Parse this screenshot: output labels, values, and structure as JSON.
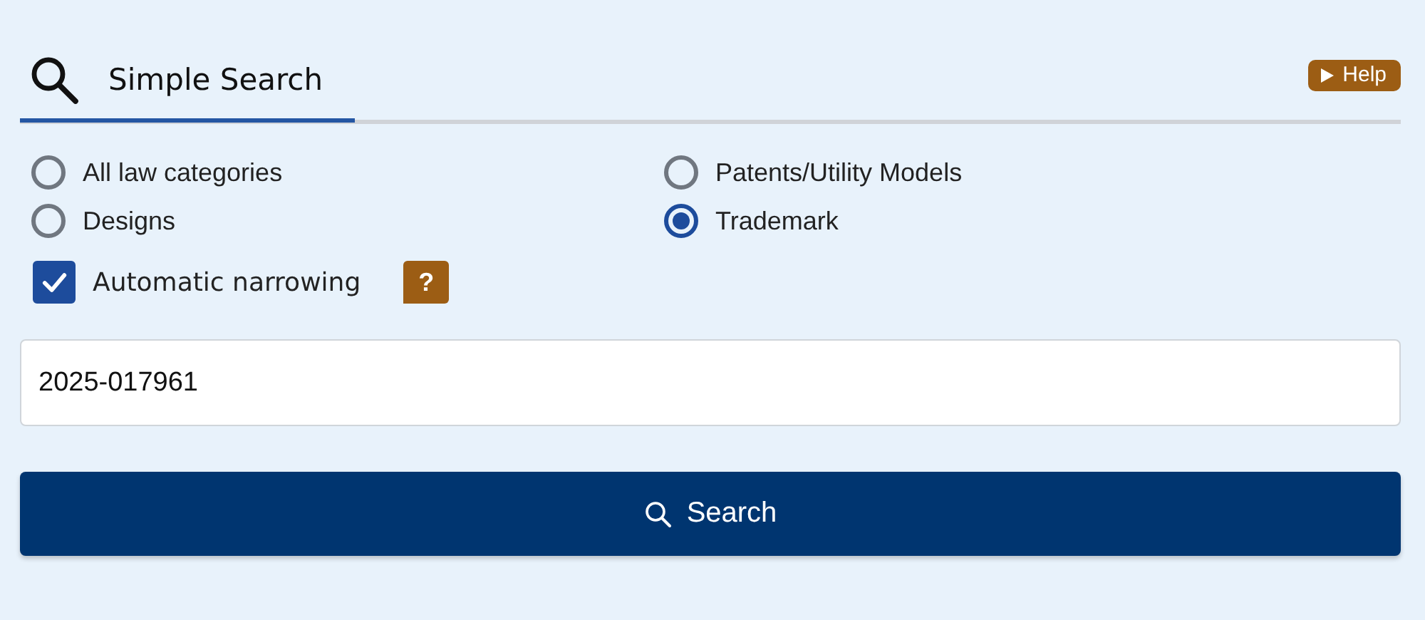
{
  "header": {
    "title": "Simple Search",
    "help_button": "Help"
  },
  "law_categories": [
    {
      "label": "All law categories",
      "selected": false
    },
    {
      "label": "Patents/Utility Models",
      "selected": false
    },
    {
      "label": "Designs",
      "selected": false
    },
    {
      "label": "Trademark",
      "selected": true
    }
  ],
  "auto_narrowing": {
    "label": "Automatic narrowing",
    "checked": true,
    "help_icon": "?"
  },
  "search_field": {
    "value": "2025-017961"
  },
  "search_button": "Search"
}
